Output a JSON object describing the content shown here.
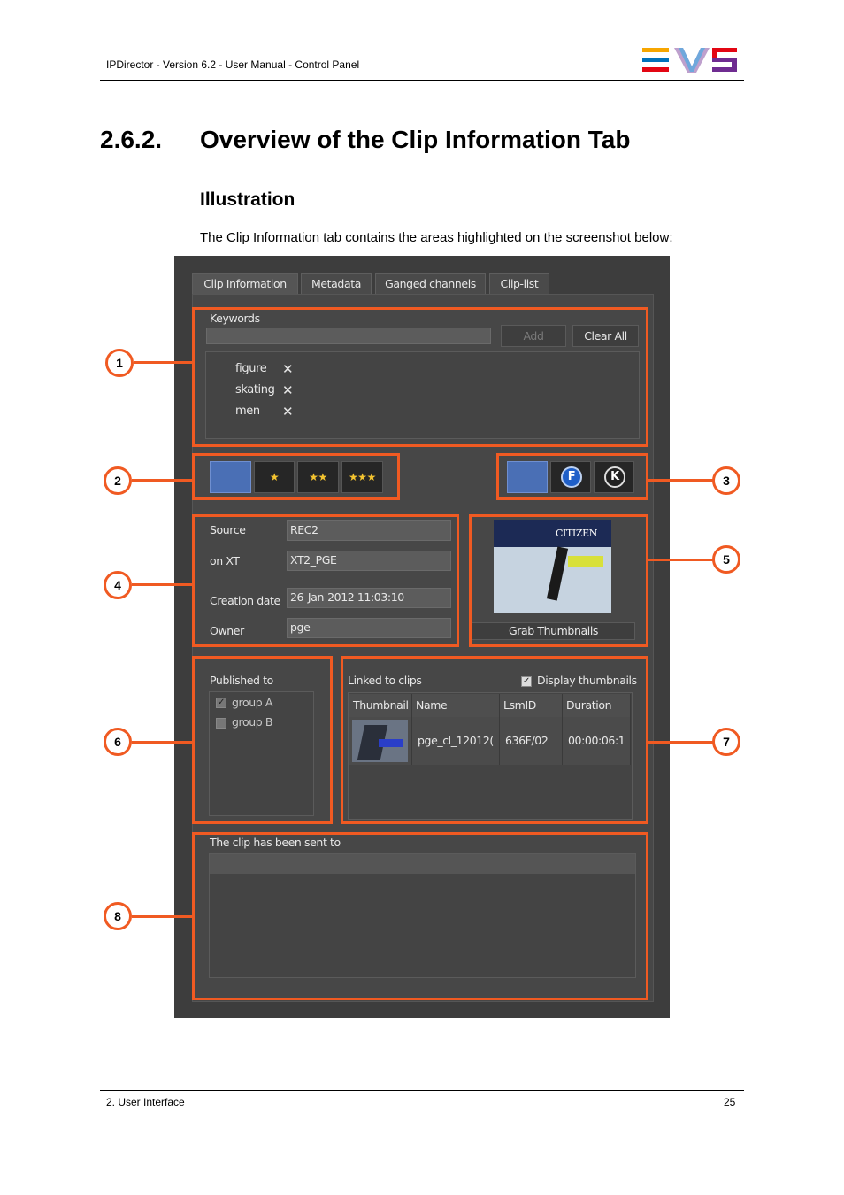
{
  "header": {
    "running_title": "IPDirector - Version 6.2 - User Manual - Control Panel",
    "logo_colors": [
      "#f7a600",
      "#0072bc",
      "#e30613",
      "#6f2c91"
    ]
  },
  "heading": {
    "number": "2.6.2.",
    "title": "Overview of the Clip Information Tab"
  },
  "subheading": "Illustration",
  "intro": "The Clip Information tab contains the areas highlighted on the screenshot below:",
  "screenshot": {
    "tabs": [
      "Clip Information",
      "Metadata",
      "Ganged channels",
      "Clip-list"
    ],
    "keywords": {
      "label": "Keywords",
      "input_value": "",
      "add_label": "Add",
      "clear_label": "Clear All",
      "items": [
        "figure",
        "skating",
        "men"
      ]
    },
    "rating_buttons": [
      "★",
      "★★",
      "★★★"
    ],
    "fk_buttons": [
      "F",
      "K"
    ],
    "source": {
      "source_label": "Source",
      "source_value": "REC2",
      "onxt_label": "on XT",
      "onxt_value": "XT2_PGE",
      "creation_label": "Creation date",
      "creation_value": "26-Jan-2012 11:03:10",
      "owner_label": "Owner",
      "owner_value": "pge"
    },
    "thumbnail": {
      "grab_label": "Grab Thumbnails",
      "banner_text": "CITIZEN"
    },
    "published": {
      "label": "Published to",
      "groups": [
        "group A",
        "group B"
      ]
    },
    "linked": {
      "label": "Linked to clips",
      "display_thumbnails": "Display thumbnails",
      "columns": [
        "Thumbnail",
        "Name",
        "LsmID",
        "Duration"
      ],
      "row": {
        "name": "pge_cl_12012(",
        "lsmid": "636F/02",
        "duration": "00:00:06:1"
      }
    },
    "sent_to": {
      "label": "The clip has been sent to"
    },
    "callouts": [
      "1",
      "2",
      "3",
      "4",
      "5",
      "6",
      "7",
      "8"
    ],
    "highlight_color": "#f05a22"
  },
  "footer": {
    "section": "2. User Interface",
    "page": "25"
  }
}
